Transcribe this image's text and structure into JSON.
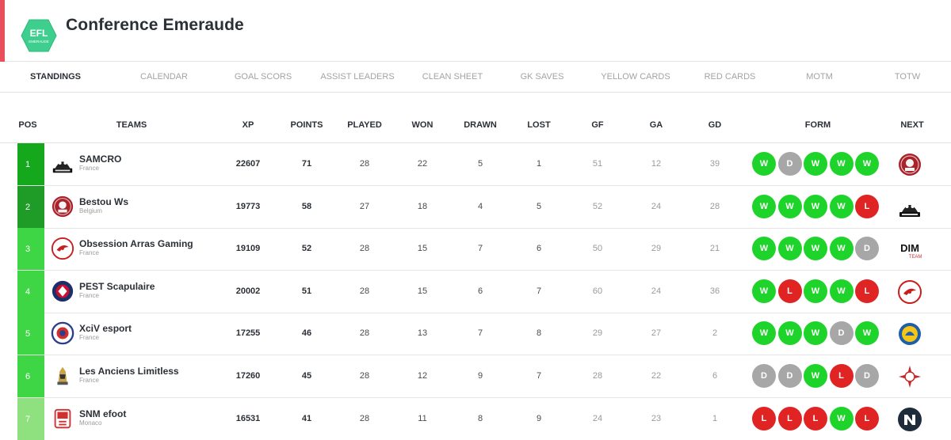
{
  "header": {
    "logo_text": "EFL",
    "logo_subtext": "EMERAUDE",
    "title": "Conference Emeraude",
    "accent_color": "#e8505b",
    "logo_color": "#3ecf8e"
  },
  "tabs": [
    {
      "label": "STANDINGS",
      "active": true
    },
    {
      "label": "CALENDAR",
      "active": false
    },
    {
      "label": "GOAL SCORS",
      "active": false
    },
    {
      "label": "ASSIST LEADERS",
      "active": false
    },
    {
      "label": "CLEAN SHEET",
      "active": false
    },
    {
      "label": "GK SAVES",
      "active": false
    },
    {
      "label": "YELLOW CARDS",
      "active": false
    },
    {
      "label": "RED CARDS",
      "active": false
    },
    {
      "label": "MOTM",
      "active": false
    },
    {
      "label": "TOTW",
      "active": false
    }
  ],
  "columns": {
    "pos": "POS",
    "teams": "TEAMS",
    "xp": "XP",
    "points": "POINTS",
    "played": "PLAYED",
    "won": "WON",
    "drawn": "DRAWN",
    "lost": "LOST",
    "gf": "GF",
    "ga": "GA",
    "gd": "GD",
    "form": "FORM",
    "next": "NEXT"
  },
  "form_colors": {
    "W": "#1ed42a",
    "D": "#a7a7a7",
    "L": "#e02424"
  },
  "rows": [
    {
      "pos": "1",
      "pos_color": "#15a81c",
      "badge_icon": "samcro-skull-icon",
      "name": "SAMCRO",
      "country": "France",
      "xp": "22607",
      "points": "71",
      "played": "28",
      "won": "22",
      "drawn": "5",
      "lost": "1",
      "gf": "51",
      "ga": "12",
      "gd": "39",
      "form": [
        "W",
        "D",
        "W",
        "W",
        "W"
      ],
      "next_icon": "bestou-ws-icon"
    },
    {
      "pos": "2",
      "pos_color": "#1f9c28",
      "badge_icon": "bestou-ws-icon",
      "name": "Bestou Ws",
      "country": "Belgium",
      "xp": "19773",
      "points": "58",
      "played": "27",
      "won": "18",
      "drawn": "4",
      "lost": "5",
      "gf": "52",
      "ga": "24",
      "gd": "28",
      "form": [
        "W",
        "W",
        "W",
        "W",
        "L"
      ],
      "next_icon": "samcro-skull-icon"
    },
    {
      "pos": "3",
      "pos_color": "#3fd646",
      "badge_icon": "obsession-arras-icon",
      "name": "Obsession Arras Gaming",
      "country": "France",
      "xp": "19109",
      "points": "52",
      "played": "28",
      "won": "15",
      "drawn": "7",
      "lost": "6",
      "gf": "50",
      "ga": "29",
      "gd": "21",
      "form": [
        "W",
        "W",
        "W",
        "W",
        "D"
      ],
      "next_icon": "dim-team-icon"
    },
    {
      "pos": "4",
      "pos_color": "#3fd646",
      "badge_icon": "pest-scapulaire-icon",
      "name": "PEST Scapulaire",
      "country": "France",
      "xp": "20002",
      "points": "51",
      "played": "28",
      "won": "15",
      "drawn": "6",
      "lost": "7",
      "gf": "60",
      "ga": "24",
      "gd": "36",
      "form": [
        "W",
        "L",
        "W",
        "W",
        "L"
      ],
      "next_icon": "obsession-arras-icon"
    },
    {
      "pos": "5",
      "pos_color": "#3fd646",
      "badge_icon": "xciv-esport-icon",
      "name": "XciV esport",
      "country": "France",
      "xp": "17255",
      "points": "46",
      "played": "28",
      "won": "13",
      "drawn": "7",
      "lost": "8",
      "gf": "29",
      "ga": "27",
      "gd": "2",
      "form": [
        "W",
        "W",
        "W",
        "D",
        "W"
      ],
      "next_icon": "helmet-crest-icon"
    },
    {
      "pos": "6",
      "pos_color": "#3fd646",
      "badge_icon": "les-anciens-limitless-icon",
      "name": "Les Anciens Limitless",
      "country": "France",
      "xp": "17260",
      "points": "45",
      "played": "28",
      "won": "12",
      "drawn": "9",
      "lost": "7",
      "gf": "28",
      "ga": "22",
      "gd": "6",
      "form": [
        "D",
        "D",
        "W",
        "L",
        "D"
      ],
      "next_icon": "fc-star-icon"
    },
    {
      "pos": "7",
      "pos_color": "#8fe07e",
      "badge_icon": "snm-efoot-icon",
      "name": "SNM efoot",
      "country": "Monaco",
      "xp": "16531",
      "points": "41",
      "played": "28",
      "won": "11",
      "drawn": "8",
      "lost": "9",
      "gf": "24",
      "ga": "23",
      "gd": "1",
      "form": [
        "L",
        "L",
        "L",
        "W",
        "L"
      ],
      "next_icon": "n-logo-icon"
    }
  ]
}
